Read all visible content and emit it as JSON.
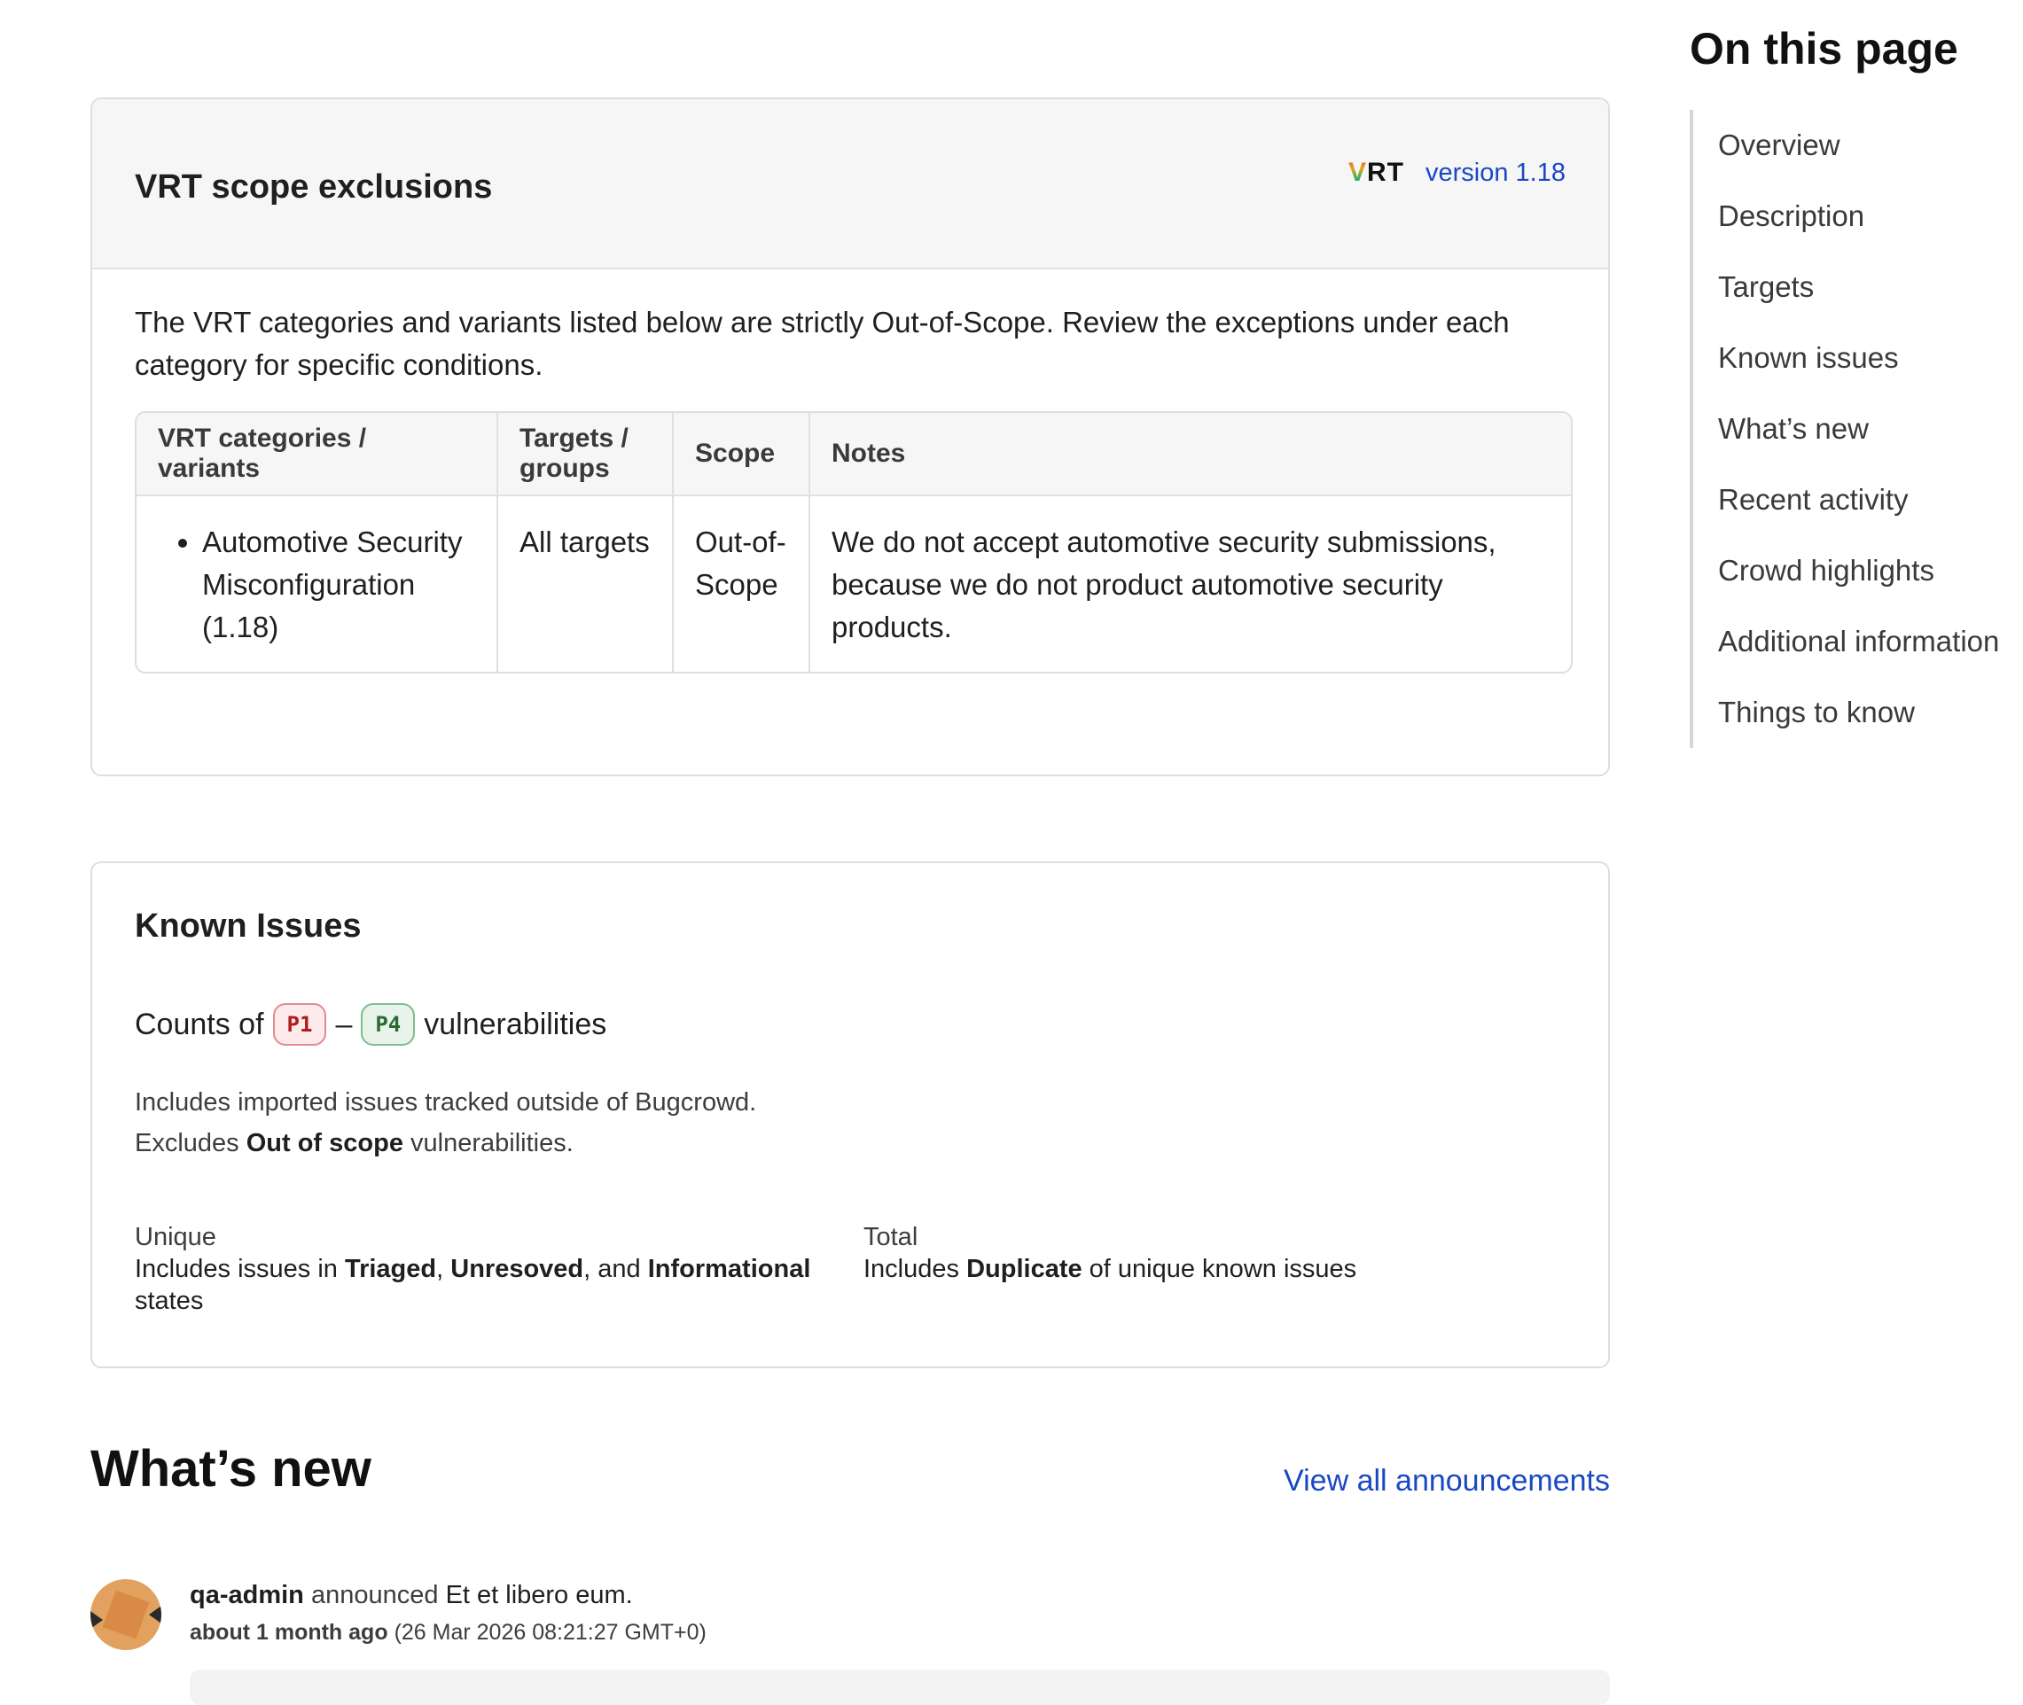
{
  "vrt_card": {
    "title": "VRT scope exclusions",
    "logo_v": "V",
    "logo_rest": "RT",
    "version": "version 1.18",
    "intro": "The VRT categories and variants listed below are strictly Out-of-Scope. Review the exceptions under each category for specific conditions.",
    "table": {
      "headers": [
        "VRT categories / variants",
        "Targets / groups",
        "Scope",
        "Notes"
      ],
      "rows": [
        {
          "category": "Automotive Security Misconfiguration (1.18)",
          "targets": "All targets",
          "scope": "Out-of-Scope",
          "notes": "We do not accept automotive security submissions, because we do not product automotive security products."
        }
      ]
    }
  },
  "known_issues": {
    "title": "Known Issues",
    "counts_prefix": "Counts of",
    "p1": "P1",
    "dash": "–",
    "p4": "P4",
    "counts_suffix": "vulnerabilities",
    "note1": "Includes imported issues tracked outside of Bugcrowd.",
    "note2_prefix": "Excludes",
    "note2_bold": "Out of scope",
    "note2_suffix": "vulnerabilities.",
    "unique": {
      "label": "Unique",
      "t1": "Includes issues in",
      "b1": "Triaged",
      "t2": ",",
      "b2": "Unresoved",
      "t3": ", and",
      "b3": "Informational",
      "t4": "states"
    },
    "total": {
      "label": "Total",
      "t1": "Includes",
      "b1": "Duplicate",
      "t2": "of unique known issues"
    }
  },
  "whats_new": {
    "title": "What’s new",
    "view_all": "View all announcements",
    "announcement": {
      "user": "qa-admin",
      "verb": "announced",
      "title": "Et et libero eum.",
      "relative_time": "about 1 month ago",
      "timestamp": "(26 Mar 2026 08:21:27 GMT+0)"
    }
  },
  "toc": {
    "title": "On this page",
    "items": [
      "Overview",
      "Description",
      "Targets",
      "Known issues",
      "What’s new",
      "Recent activity",
      "Crowd highlights",
      "Additional information",
      "Things to know"
    ]
  },
  "colors": {
    "link": "#1a47c4",
    "p1": "#b21b1b",
    "p4": "#2a6b35"
  }
}
